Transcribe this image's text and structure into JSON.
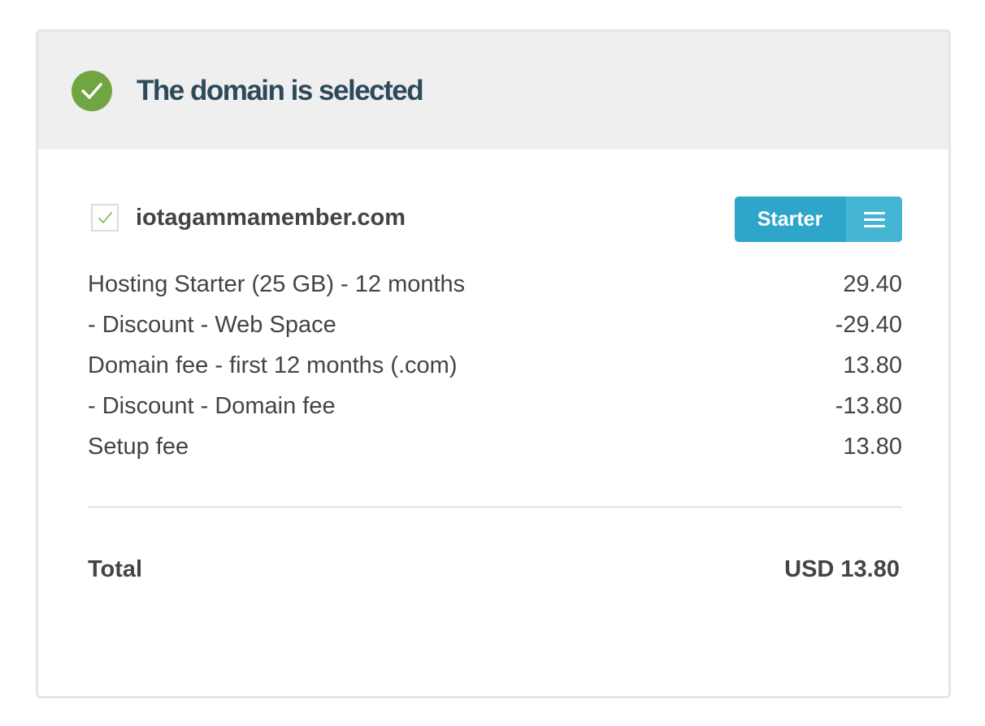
{
  "header": {
    "title": "The domain is selected",
    "status_icon": "check-circle-icon",
    "status_color": "#6fa642"
  },
  "domain": {
    "name": "iotagammamember.com",
    "checked": true
  },
  "plan": {
    "label": "Starter",
    "menu_icon": "hamburger-menu-icon",
    "color": "#2da6c9"
  },
  "line_items": [
    {
      "label": "Hosting Starter (25 GB) - 12 months",
      "amount": "29.40"
    },
    {
      "label": "- Discount - Web Space",
      "amount": "-29.40"
    },
    {
      "label": "Domain fee - first 12 months (.com)",
      "amount": "13.80"
    },
    {
      "label": "- Discount - Domain fee",
      "amount": "-13.80"
    },
    {
      "label": "Setup fee",
      "amount": "13.80"
    }
  ],
  "total": {
    "label": "Total",
    "value": "USD 13.80"
  }
}
